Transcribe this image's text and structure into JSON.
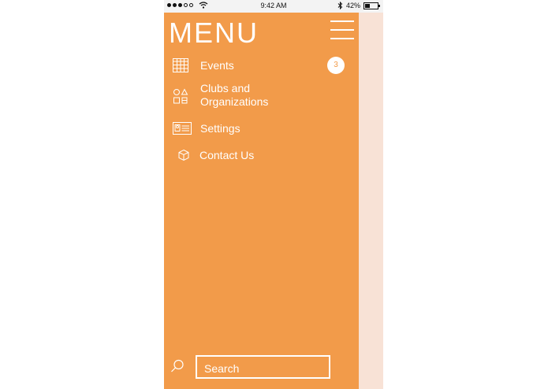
{
  "statusbar": {
    "time": "9:42 AM",
    "battery": "42%",
    "battery_level": 0.42,
    "signal_icon": "signal-dots-icon",
    "wifi_icon": "wifi-icon",
    "bluetooth_icon": "bluetooth-icon"
  },
  "drawer": {
    "title": "MENU",
    "bg_color": "#f29b4a",
    "items": [
      {
        "label": "Events",
        "icon": "calendar-grid-icon",
        "badge": "3"
      },
      {
        "label": "Clubs and\nOrganizations",
        "icon": "shapes-icon"
      },
      {
        "label": "Settings",
        "icon": "id-card-icon"
      },
      {
        "label": "Contact Us",
        "icon": "cube-icon"
      }
    ],
    "search": {
      "placeholder": "Search"
    }
  }
}
